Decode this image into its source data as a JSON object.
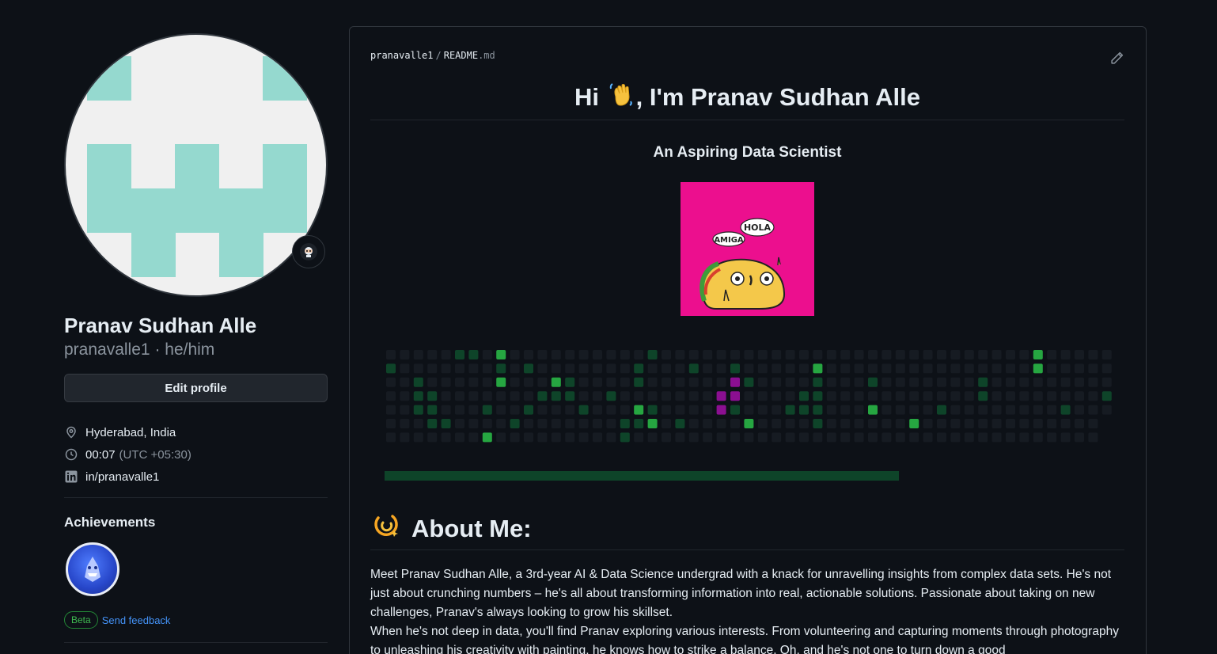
{
  "sidebar": {
    "status_emoji": "octocat-icon",
    "name": "Pranav Sudhan Alle",
    "username": "pranavalle1",
    "pronouns": "he/him",
    "edit_profile_label": "Edit profile",
    "location": "Hyderabad, India",
    "local_time": "00:07",
    "timezone": "(UTC +05:30)",
    "linkedin": "in/pranavalle1",
    "achievements_title": "Achievements",
    "beta_label": "Beta",
    "feedback_label": "Send feedback"
  },
  "readme": {
    "path_user": "pranavalle1",
    "path_sep": "/",
    "path_file": "README",
    "path_ext": ".md",
    "greeting_pre": "Hi",
    "greeting_post": ", I'm Pranav Sudhan Alle",
    "subtitle": "An Aspiring Data Scientist",
    "taco_bubble_1": "HOLA",
    "taco_bubble_2": "AMIGA",
    "about_heading": "About Me:",
    "about_p1": "Meet Pranav Sudhan Alle, a 3rd-year AI & Data Science undergrad with a knack for unravelling insights from complex data sets. He's not just about crunching numbers – he's all about transforming information into real, actionable solutions. Passionate about taking on new challenges, Pranav's always looking to grow his skillset.",
    "about_p2": "When he's not deep in data, you'll find Pranav exploring various interests. From volunteering and capturing moments through photography to unleashing his creativity with painting, he knows how to strike a balance. Oh, and he's not one to turn down a good"
  },
  "contrib_grid": {
    "weeks": 53,
    "days": 7,
    "cells": [
      [
        0,
        1,
        0,
        0,
        0,
        0,
        0
      ],
      [
        0,
        0,
        0,
        0,
        0,
        0,
        0
      ],
      [
        0,
        0,
        1,
        1,
        1,
        0,
        0
      ],
      [
        0,
        0,
        0,
        1,
        1,
        1,
        0
      ],
      [
        0,
        0,
        0,
        0,
        0,
        1,
        0
      ],
      [
        1,
        0,
        0,
        0,
        0,
        0,
        0
      ],
      [
        1,
        0,
        0,
        0,
        0,
        0,
        0
      ],
      [
        0,
        0,
        0,
        0,
        1,
        0,
        3
      ],
      [
        3,
        1,
        3,
        0,
        0,
        0,
        0
      ],
      [
        0,
        0,
        0,
        0,
        0,
        1,
        0
      ],
      [
        0,
        1,
        0,
        0,
        1,
        0,
        0
      ],
      [
        0,
        0,
        0,
        1,
        0,
        0,
        0
      ],
      [
        0,
        0,
        3,
        1,
        0,
        0,
        0
      ],
      [
        0,
        0,
        1,
        1,
        0,
        0,
        0
      ],
      [
        0,
        0,
        0,
        0,
        1,
        0,
        0
      ],
      [
        0,
        0,
        0,
        0,
        0,
        0,
        0
      ],
      [
        0,
        0,
        0,
        1,
        0,
        0,
        0
      ],
      [
        0,
        0,
        0,
        0,
        0,
        1,
        1
      ],
      [
        0,
        1,
        1,
        0,
        3,
        1,
        0
      ],
      [
        1,
        0,
        0,
        0,
        1,
        3,
        0
      ],
      [
        0,
        0,
        0,
        0,
        0,
        0,
        0
      ],
      [
        0,
        0,
        0,
        0,
        0,
        1,
        0
      ],
      [
        0,
        1,
        0,
        0,
        0,
        0,
        0
      ],
      [
        0,
        0,
        0,
        0,
        0,
        0,
        0
      ],
      [
        0,
        0,
        0,
        5,
        5,
        0,
        0
      ],
      [
        0,
        1,
        5,
        5,
        1,
        0,
        0
      ],
      [
        0,
        0,
        1,
        0,
        0,
        3,
        0
      ],
      [
        0,
        0,
        0,
        0,
        0,
        0,
        0
      ],
      [
        0,
        0,
        0,
        0,
        0,
        0,
        0
      ],
      [
        0,
        0,
        0,
        0,
        1,
        0,
        0
      ],
      [
        0,
        0,
        0,
        1,
        1,
        0,
        0
      ],
      [
        0,
        3,
        1,
        1,
        1,
        1,
        0
      ],
      [
        0,
        0,
        0,
        0,
        0,
        0,
        0
      ],
      [
        0,
        0,
        0,
        0,
        0,
        0,
        0
      ],
      [
        0,
        0,
        0,
        0,
        0,
        0,
        0
      ],
      [
        0,
        0,
        1,
        0,
        3,
        0,
        0
      ],
      [
        0,
        0,
        0,
        0,
        0,
        0,
        0
      ],
      [
        0,
        0,
        0,
        0,
        0,
        0,
        0
      ],
      [
        0,
        0,
        0,
        0,
        0,
        3,
        0
      ],
      [
        0,
        0,
        0,
        0,
        0,
        0,
        0
      ],
      [
        0,
        0,
        0,
        0,
        1,
        0,
        0
      ],
      [
        0,
        0,
        0,
        0,
        0,
        0,
        0
      ],
      [
        0,
        0,
        0,
        0,
        0,
        0,
        0
      ],
      [
        0,
        0,
        1,
        1,
        0,
        0,
        0
      ],
      [
        0,
        0,
        0,
        0,
        0,
        0,
        0
      ],
      [
        0,
        0,
        0,
        0,
        0,
        0,
        0
      ],
      [
        0,
        0,
        0,
        0,
        0,
        0,
        0
      ],
      [
        3,
        3,
        0,
        0,
        0,
        0,
        0
      ],
      [
        0,
        0,
        0,
        0,
        0,
        0,
        0
      ],
      [
        0,
        0,
        0,
        0,
        1,
        0,
        0
      ],
      [
        0,
        0,
        0,
        0,
        0,
        0,
        0
      ],
      [
        0,
        0,
        0,
        0,
        0,
        0,
        0
      ],
      [
        0,
        0,
        0,
        1,
        0,
        0,
        0
      ]
    ],
    "colors": [
      "#161b22",
      "#0e4429",
      "#006d32",
      "#26a641",
      "#39d353",
      "#8b0f91"
    ]
  },
  "colors": {
    "bg": "#0d1117",
    "border": "#30363d",
    "text": "#e6edf3",
    "muted": "#8b949e",
    "link": "#4493f8",
    "avatar_teal": "#95d9cf",
    "taco_bg": "#ec0f8e"
  }
}
